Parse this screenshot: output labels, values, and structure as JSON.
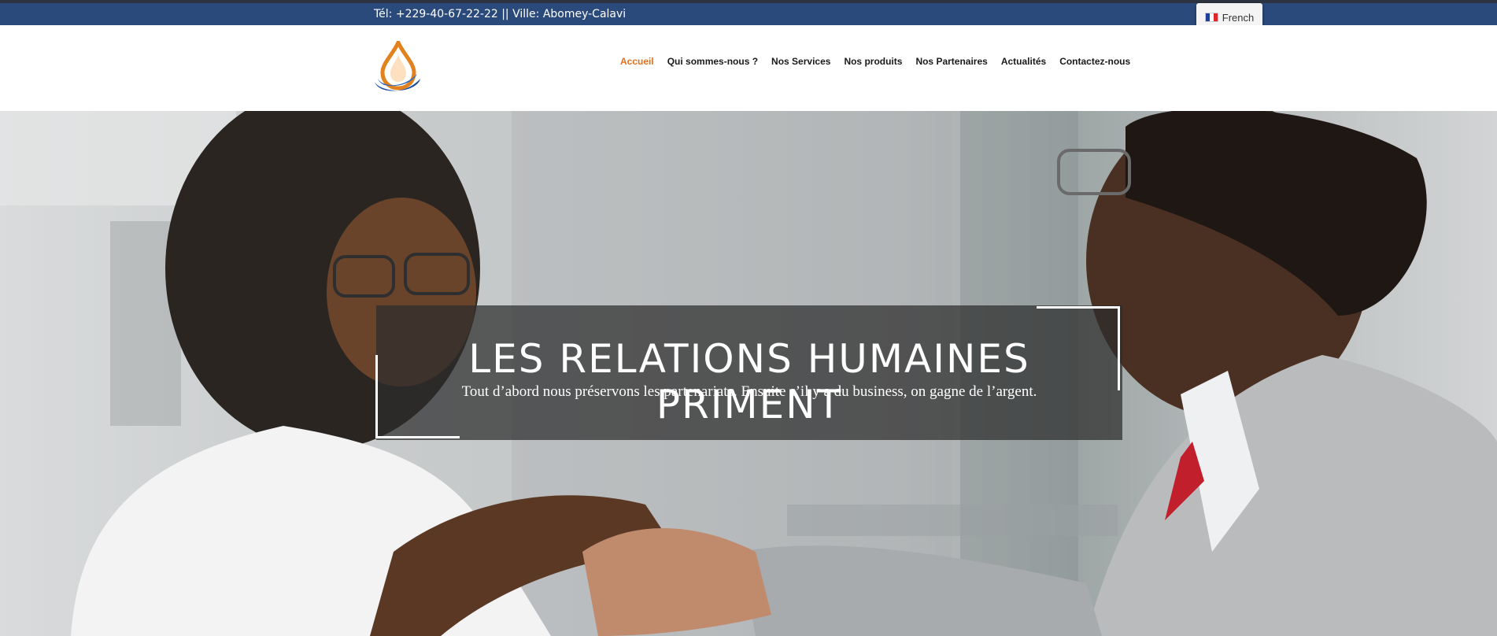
{
  "topbar": {
    "contact_text": "Tél: +229-40-67-22-22 || Ville: Abomey-Calavi",
    "language": {
      "label": "French",
      "flag_colors": [
        "#1f3f98",
        "#ffffff",
        "#e0242b"
      ]
    },
    "background_color": "#2b4a7c"
  },
  "header": {
    "logo_icon": "drop-logo-icon",
    "nav": [
      {
        "label": "Accueil",
        "active": true
      },
      {
        "label": "Qui sommes-nous ?",
        "active": false
      },
      {
        "label": "Nos Services",
        "active": false
      },
      {
        "label": "Nos produits",
        "active": false
      },
      {
        "label": "Nos Partenaires",
        "active": false
      },
      {
        "label": "Actualités",
        "active": false
      },
      {
        "label": "Contactez-nous",
        "active": false
      }
    ],
    "active_color": "#e2701c"
  },
  "hero": {
    "title": "LES RELATIONS HUMAINES PRIMENT",
    "subtitle": "Tout d’abord nous préservons les partenariats. Ensuite s’il y a du business, on gagne de l’argent."
  }
}
